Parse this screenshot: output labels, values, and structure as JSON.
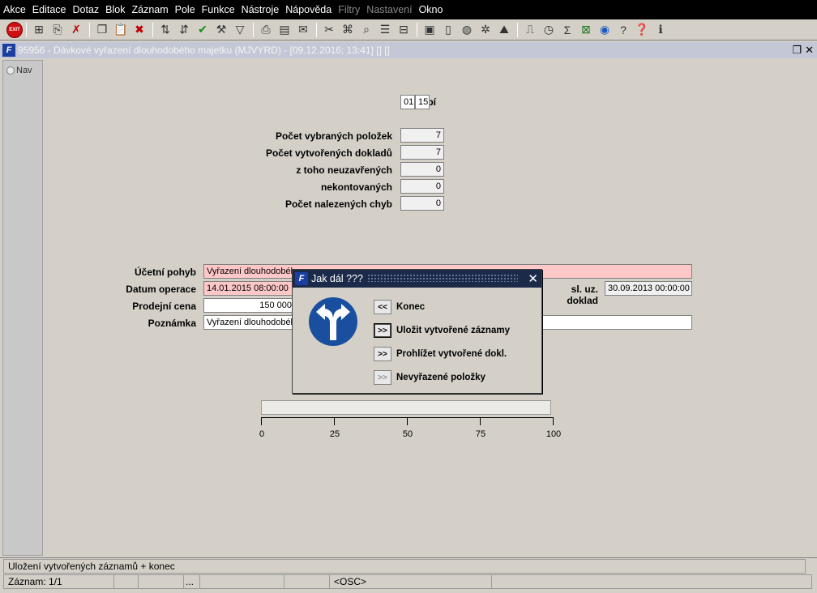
{
  "menu": [
    "Akce",
    "Editace",
    "Dotaz",
    "Blok",
    "Záznam",
    "Pole",
    "Funkce",
    "Nástroje",
    "Nápověda",
    "Filtry",
    "Nastavení",
    "Okno"
  ],
  "menu_disabled": [
    "Filtry",
    "Nastavení"
  ],
  "toolbar": {
    "exit_label": "EXIT"
  },
  "window": {
    "title": "95956 - Dávkové vyřazení dlouhodobého majetku (MJVYRD) - [09.12.2016; 13:41]  []  []",
    "logo": "F"
  },
  "nav": {
    "label": "Nav"
  },
  "form": {
    "obdobi_label": "Období",
    "obdobi_month": "01",
    "obdobi_year": "15",
    "vybranych_label": "Počet vybraných položek",
    "vybranych_value": "7",
    "vytvorenych_label": "Počet vytvořených dokladů",
    "vytvorenych_value": "7",
    "neuzavrenych_label": "z toho  neuzavřených",
    "neuzavrenych_value": "0",
    "nekontovanych_label": "nekontovaných",
    "nekontovanych_value": "0",
    "chyb_label": "Počet nalezených chyb",
    "chyb_value": "0",
    "pohyb_label": "Účetní pohyb",
    "pohyb_value": "Vyřazení dlouhodobého",
    "datum_label": "Datum operace",
    "datum_value": "14.01.2015 08:00:00",
    "cena_label": "Prodejní cena",
    "cena_value": "150 000",
    "poznamka_label": "Poznámka",
    "poznamka_value": "Vyřazení dlouhodobého",
    "posl_label": "sl. uz. doklad",
    "posl_value": "30.09.2013 00:00:00"
  },
  "progress": {
    "value_percent": 0,
    "ticks": [
      "0",
      "25",
      "50",
      "75",
      "100"
    ]
  },
  "dialog": {
    "title": "Jak dál ???",
    "logo": "F",
    "close": "✕",
    "options": [
      {
        "button": "<<",
        "label": "Konec"
      },
      {
        "button": ">>",
        "label": "Uložit vytvořené záznamy"
      },
      {
        "button": ">>",
        "label": "Prohlížet vytvořené dokl."
      },
      {
        "button": ">>",
        "label": "Nevyřazené položky"
      }
    ]
  },
  "status": {
    "message": "Uložení vytvořených záznamů + konec",
    "record": "Záznam: 1/1",
    "dots": "...",
    "mode": "<OSC>"
  },
  "colors": {
    "title_bg": "#1c2a4a",
    "pink_field": "#ffc8c8",
    "sign_blue": "#1a4fa0"
  }
}
